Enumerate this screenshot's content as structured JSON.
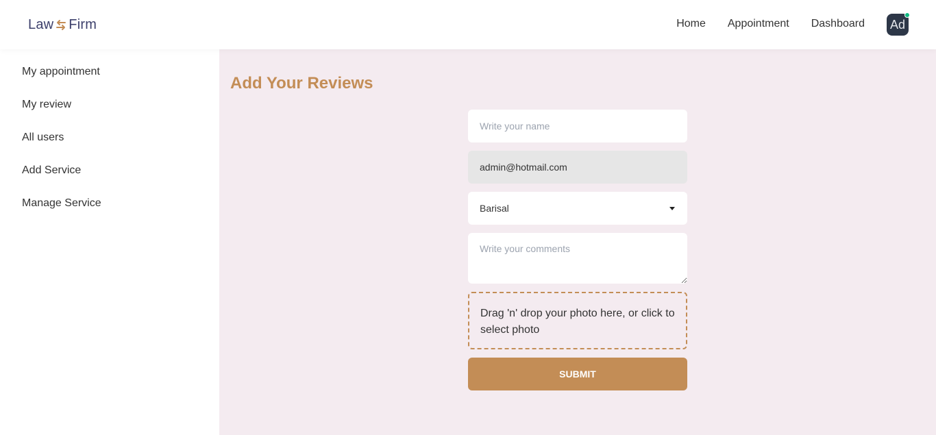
{
  "header": {
    "logo_left": "Law",
    "logo_right": "Firm",
    "nav": [
      "Home",
      "Appointment",
      "Dashboard"
    ],
    "avatar_text": "Ad"
  },
  "sidebar": {
    "items": [
      "My appointment",
      "My review",
      "All users",
      "Add Service",
      "Manage Service"
    ]
  },
  "main": {
    "title": "Add Your Reviews",
    "name_placeholder": "Write your name",
    "email_value": "admin@hotmail.com",
    "location_selected": "Barisal",
    "comments_placeholder": "Write your comments",
    "dropzone_text": "Drag 'n' drop your photo here, or click to select photo",
    "submit_label": "SUBMIT"
  },
  "colors": {
    "accent": "#c38d56",
    "main_bg": "#f4ebf0",
    "logo_text": "#3c3f6b",
    "avatar_bg": "#2d3748",
    "status_dot": "#10b981"
  },
  "icons": {
    "logo": "arrows-exchange-icon",
    "select": "caret-down-icon",
    "status": "online-dot-icon"
  }
}
